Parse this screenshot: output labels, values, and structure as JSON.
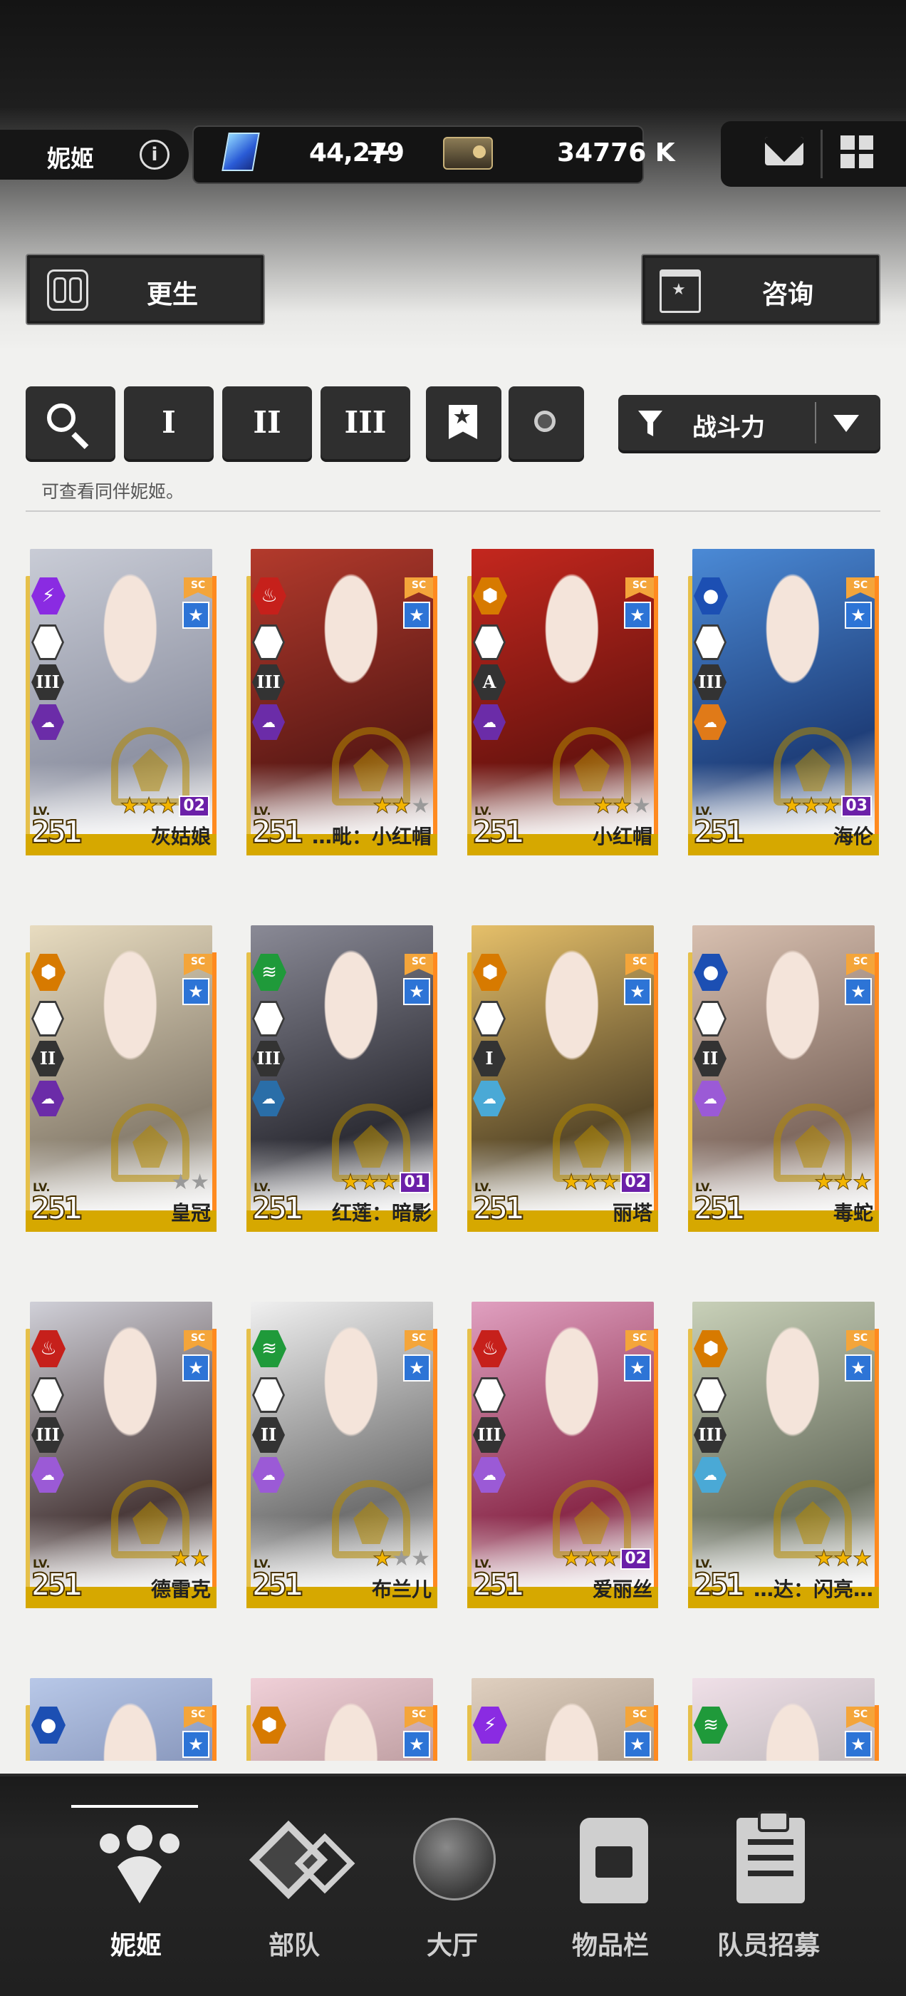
{
  "header": {
    "player_name": "妮姬",
    "gems": "44,279",
    "credits": "34776 K"
  },
  "actions": {
    "rebirth_label": "更生",
    "consult_label": "咨询"
  },
  "filters": {
    "burst_1": "I",
    "burst_2": "II",
    "burst_3": "III",
    "sort_label": "战斗力",
    "hint": "可查看同伴妮姬。"
  },
  "cards": [
    {
      "name": "灰姑娘",
      "level": "251",
      "stars_on": 3,
      "stars_off": 0,
      "core": "02",
      "element_color": "#8a2be2",
      "element_icon": "bolt-icon",
      "burst": "III",
      "mfr_color": "#6b2ca8"
    },
    {
      "name": "…毗：小红帽",
      "level": "251",
      "stars_on": 2,
      "stars_off": 1,
      "core": "",
      "element_color": "#c6201b",
      "element_icon": "fire-icon",
      "burst": "III",
      "mfr_color": "#6b2ca8"
    },
    {
      "name": "小红帽",
      "level": "251",
      "stars_on": 2,
      "stars_off": 1,
      "core": "",
      "element_color": "#d77a00",
      "element_icon": "iron-icon",
      "burst": "A",
      "mfr_color": "#6b2ca8"
    },
    {
      "name": "海伦",
      "level": "251",
      "stars_on": 3,
      "stars_off": 0,
      "core": "03",
      "element_color": "#1c4fb3",
      "element_icon": "water-icon",
      "burst": "III",
      "mfr_color": "#e07a18"
    },
    {
      "name": "皇冠",
      "level": "251",
      "stars_on": 0,
      "stars_off": 2,
      "core": "",
      "element_color": "#d77a00",
      "element_icon": "iron-icon",
      "burst": "II",
      "mfr_color": "#6b2ca8"
    },
    {
      "name": "红莲：暗影",
      "level": "251",
      "stars_on": 3,
      "stars_off": 0,
      "core": "01",
      "element_color": "#1f9a3a",
      "element_icon": "wind-icon",
      "burst": "III",
      "mfr_color": "#2a6ea8"
    },
    {
      "name": "丽塔",
      "level": "251",
      "stars_on": 3,
      "stars_off": 0,
      "core": "02",
      "element_color": "#d77a00",
      "element_icon": "iron-icon",
      "burst": "I",
      "mfr_color": "#4aa9d6"
    },
    {
      "name": "毒蛇",
      "level": "251",
      "stars_on": 3,
      "stars_off": 0,
      "core": "",
      "element_color": "#1c4fb3",
      "element_icon": "water-icon",
      "burst": "II",
      "mfr_color": "#9b5ad6"
    },
    {
      "name": "德雷克",
      "level": "251",
      "stars_on": 2,
      "stars_off": 0,
      "core": "",
      "element_color": "#c6201b",
      "element_icon": "fire-icon",
      "burst": "III",
      "mfr_color": "#9b5ad6"
    },
    {
      "name": "布兰儿",
      "level": "251",
      "stars_on": 1,
      "stars_off": 2,
      "core": "",
      "element_color": "#1f9a3a",
      "element_icon": "wind-icon",
      "burst": "II",
      "mfr_color": "#9b5ad6"
    },
    {
      "name": "爱丽丝",
      "level": "251",
      "stars_on": 3,
      "stars_off": 0,
      "core": "02",
      "element_color": "#c6201b",
      "element_icon": "fire-icon",
      "burst": "III",
      "mfr_color": "#9b5ad6"
    },
    {
      "name": "…达：闪亮…",
      "level": "251",
      "stars_on": 3,
      "stars_off": 0,
      "core": "",
      "element_color": "#d77a00",
      "element_icon": "iron-icon",
      "burst": "III",
      "mfr_color": "#4aa9d6"
    },
    {
      "name": "",
      "level": "",
      "stars_on": 0,
      "stars_off": 0,
      "core": "",
      "element_color": "#1c4fb3",
      "element_icon": "water-icon",
      "burst": "",
      "mfr_color": ""
    },
    {
      "name": "",
      "level": "",
      "stars_on": 0,
      "stars_off": 0,
      "core": "",
      "element_color": "#d77a00",
      "element_icon": "iron-icon",
      "burst": "",
      "mfr_color": ""
    },
    {
      "name": "",
      "level": "",
      "stars_on": 0,
      "stars_off": 0,
      "core": "",
      "element_color": "#8a2be2",
      "element_icon": "bolt-icon",
      "burst": "",
      "mfr_color": ""
    },
    {
      "name": "",
      "level": "",
      "stars_on": 0,
      "stars_off": 0,
      "core": "",
      "element_color": "#1f9a3a",
      "element_icon": "wind-icon",
      "burst": "",
      "mfr_color": ""
    }
  ],
  "tabs": [
    {
      "label": "妮姬",
      "icon": "nikke-icon",
      "active": true
    },
    {
      "label": "部队",
      "icon": "squad-icon",
      "active": false
    },
    {
      "label": "大厅",
      "icon": "lobby-icon",
      "active": false
    },
    {
      "label": "物品栏",
      "icon": "inventory-icon",
      "active": false
    },
    {
      "label": "队员招募",
      "icon": "recruit-icon",
      "active": false
    }
  ]
}
